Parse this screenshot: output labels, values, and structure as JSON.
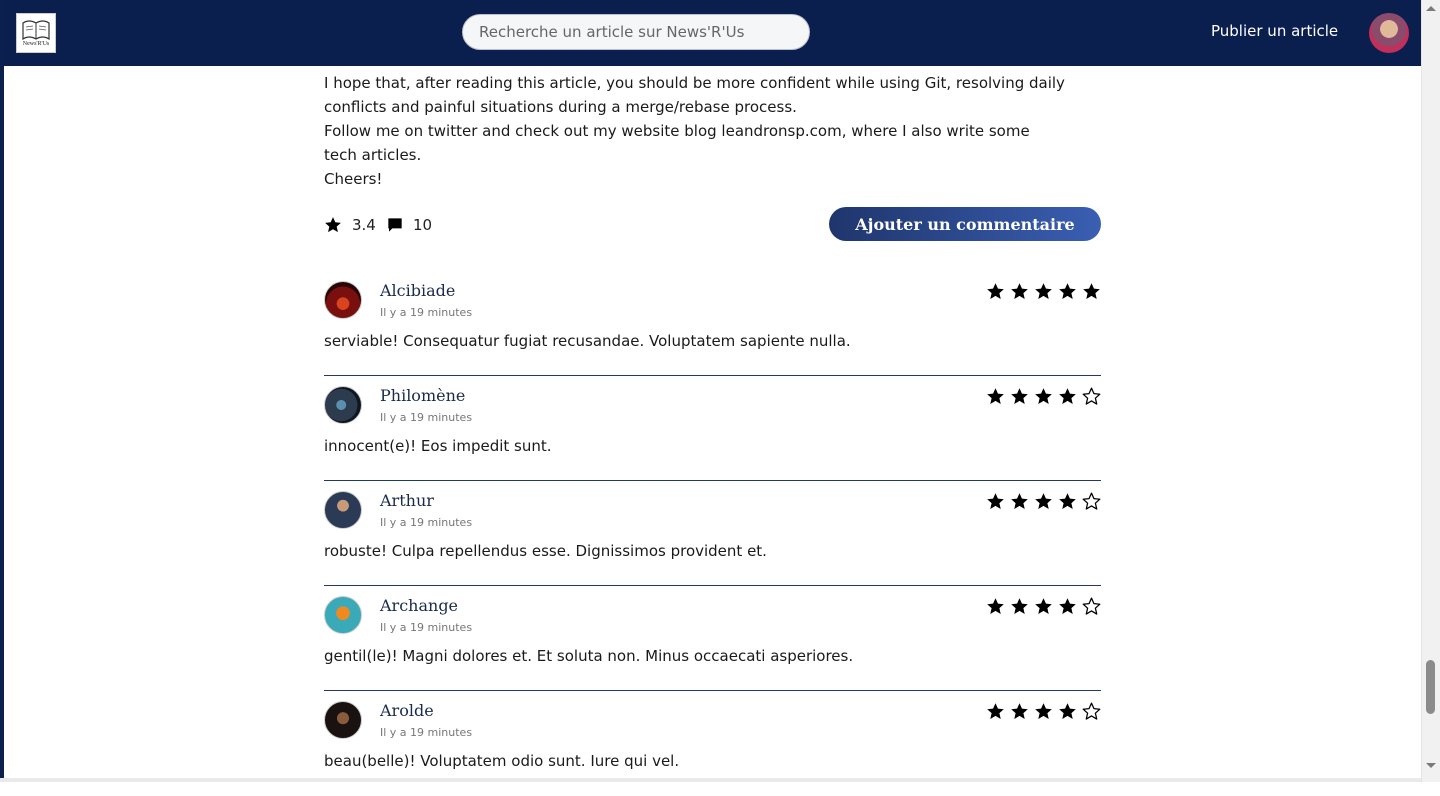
{
  "header": {
    "logo_text": "News'R'Us",
    "search_placeholder": "Recherche un article sur News'R'Us",
    "publish_label": "Publier un article"
  },
  "article": {
    "paragraphs": [
      "I hope that, after reading this article, you should be more confident while using Git, resolving daily",
      "conflicts and painful situations during a merge/rebase process.",
      "Follow me on twitter and check out my website blog leandronsp.com, where I also write some",
      "tech articles.",
      "Cheers!"
    ],
    "rating": "3.4",
    "comment_count": "10",
    "add_comment_label": "Ajouter un commentaire"
  },
  "comments": [
    {
      "name": "Alcibiade",
      "time": "Il y a 19 minutes",
      "text": "serviable! Consequatur fugiat recusandae. Voluptatem sapiente nulla.",
      "stars": 5
    },
    {
      "name": "Philomène",
      "time": "Il y a 19 minutes",
      "text": "innocent(e)! Eos impedit sunt.",
      "stars": 4
    },
    {
      "name": "Arthur",
      "time": "Il y a 19 minutes",
      "text": "robuste! Culpa repellendus esse. Dignissimos provident et.",
      "stars": 4
    },
    {
      "name": "Archange",
      "time": "Il y a 19 minutes",
      "text": "gentil(le)! Magni dolores et. Et soluta non. Minus occaecati asperiores.",
      "stars": 4
    },
    {
      "name": "Arolde",
      "time": "Il y a 19 minutes",
      "text": "beau(belle)! Voluptatem odio sunt. Iure qui vel.",
      "stars": 4
    }
  ],
  "colors": {
    "header_bg": "#0b1f4f",
    "button_start": "#1f356c",
    "button_end": "#3a5fb2",
    "divider": "#1d3a6b"
  },
  "icons": {
    "rating": "star-icon",
    "comments": "comment-bubble-icon"
  }
}
